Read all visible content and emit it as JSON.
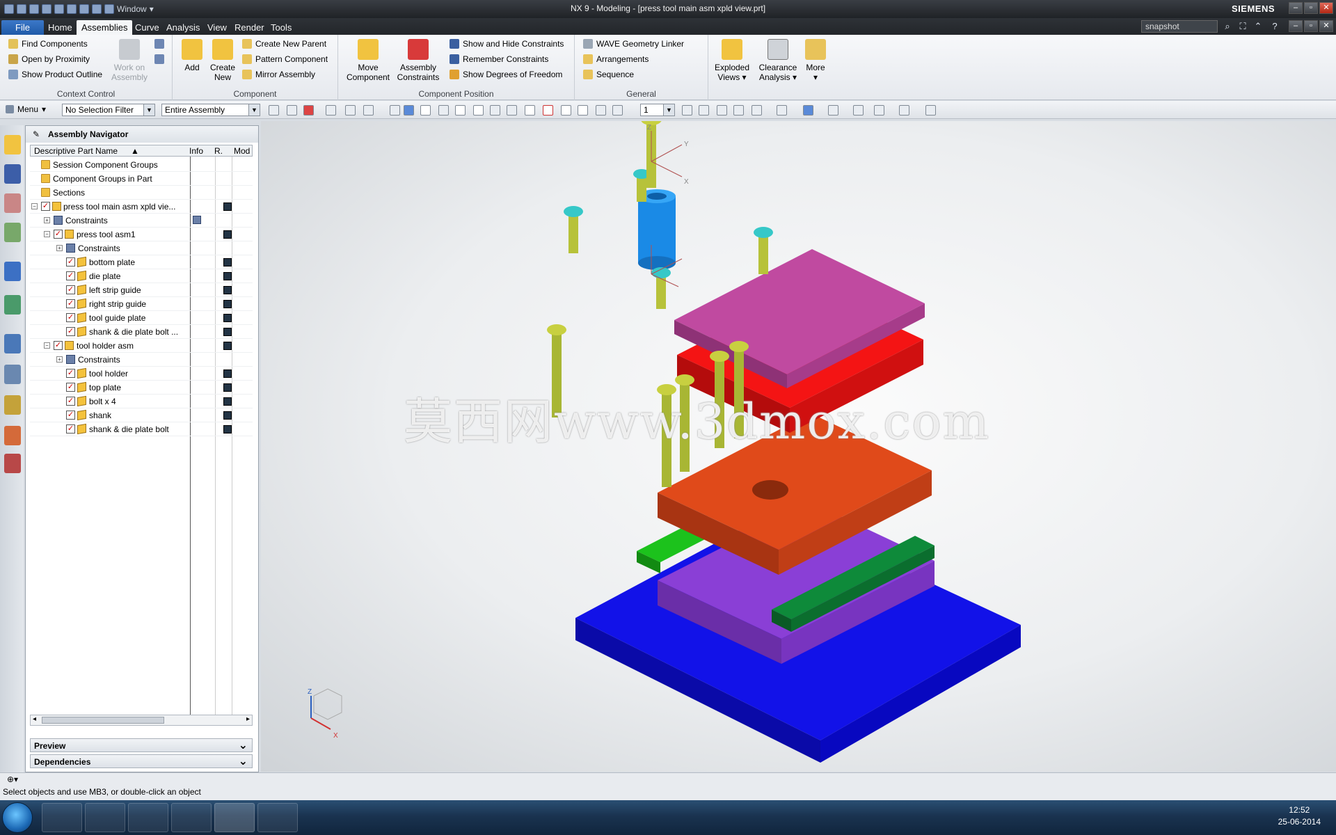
{
  "titlebar": {
    "title": "NX 9 - Modeling - [press tool main asm xpld view.prt]",
    "brand": "SIEMENS",
    "window_menu": "Window"
  },
  "menubar": {
    "tabs": [
      "File",
      "Home",
      "Assemblies",
      "Curve",
      "Analysis",
      "View",
      "Render",
      "Tools"
    ],
    "active": "Assemblies",
    "search_value": "snapshot"
  },
  "ribbon": {
    "context_control": {
      "label": "Context Control",
      "items": [
        "Find Components",
        "Open by Proximity",
        "Show Product Outline"
      ],
      "work_on_assembly": "Work on Assembly"
    },
    "component": {
      "label": "Component",
      "add": "Add",
      "create_new": "Create New",
      "items": [
        "Create New Parent",
        "Pattern Component",
        "Mirror Assembly"
      ]
    },
    "component_position": {
      "label": "Component Position",
      "move": "Move Component",
      "assembly_constraints": "Assembly Constraints",
      "items": [
        "Show and Hide Constraints",
        "Remember Constraints",
        "Show Degrees of Freedom"
      ]
    },
    "general": {
      "label": "General",
      "items": [
        "WAVE Geometry Linker",
        "Arrangements",
        "Sequence"
      ]
    },
    "extra": {
      "exploded": "Exploded Views",
      "clearance": "Clearance Analysis",
      "more": "More"
    }
  },
  "toolbar": {
    "menu": "Menu",
    "selection_filter": "No Selection Filter",
    "scope": "Entire Assembly",
    "layer": "1"
  },
  "navigator": {
    "title": "Assembly Navigator",
    "columns": [
      "Descriptive Part Name",
      "Info",
      "R.",
      "Mod"
    ],
    "rows": [
      {
        "label": "Session Component Groups"
      },
      {
        "label": "Component Groups in Part"
      },
      {
        "label": "Sections"
      },
      {
        "label": "press tool main asm xpld vie..."
      },
      {
        "label": "Constraints"
      },
      {
        "label": "press tool asm1"
      },
      {
        "label": "Constraints"
      },
      {
        "label": "bottom plate"
      },
      {
        "label": "die plate"
      },
      {
        "label": "left strip guide"
      },
      {
        "label": "right strip guide"
      },
      {
        "label": "tool guide plate"
      },
      {
        "label": "shank & die plate bolt ..."
      },
      {
        "label": "tool holder asm"
      },
      {
        "label": "Constraints"
      },
      {
        "label": "tool holder"
      },
      {
        "label": "top plate"
      },
      {
        "label": "bolt x 4"
      },
      {
        "label": "shank"
      },
      {
        "label": "shank & die plate bolt"
      }
    ],
    "panels": [
      "Preview",
      "Dependencies"
    ]
  },
  "viewport": {
    "watermark": "莫西网www.3dmox.com",
    "triad": {
      "z": "Z",
      "x": "X"
    },
    "csys": {
      "z": "Z",
      "y": "Y",
      "x": "X"
    }
  },
  "status": {
    "message": "Select objects and use MB3, or double-click an object"
  },
  "taskbar": {
    "time": "12:52",
    "date": "25-06-2014"
  },
  "colors": {
    "base_plate": "#1010e0",
    "purple_plate": "#8a3fd0",
    "green_guide": "#16a016",
    "dark_green": "#0e6e2e",
    "orange_plate": "#e04818",
    "red_plate": "#f01010",
    "magenta_plate": "#b8429a",
    "blue_shank": "#1c8ee8",
    "bolt": "#b7c23a"
  }
}
